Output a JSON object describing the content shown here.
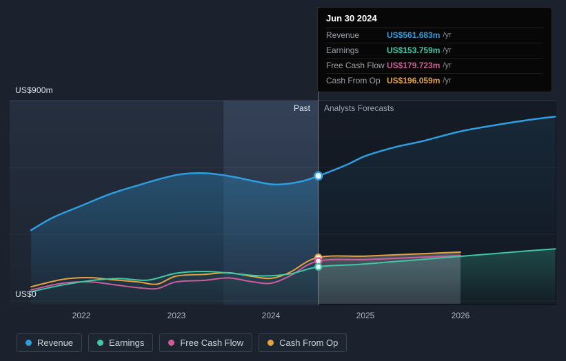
{
  "tooltip": {
    "date": "Jun 30 2024",
    "rows": [
      {
        "label": "Revenue",
        "value": "US$561.683m",
        "suffix": "/yr",
        "color": "#2d9fe0"
      },
      {
        "label": "Earnings",
        "value": "US$153.759m",
        "suffix": "/yr",
        "color": "#40c8a6"
      },
      {
        "label": "Free Cash Flow",
        "value": "US$179.723m",
        "suffix": "/yr",
        "color": "#d05d99"
      },
      {
        "label": "Cash From Op",
        "value": "US$196.059m",
        "suffix": "/yr",
        "color": "#e6a23f"
      }
    ]
  },
  "axis": {
    "y_top": "US$900m",
    "y_bottom": "US$0",
    "x_ticks": [
      "2022",
      "2023",
      "2024",
      "2025",
      "2026"
    ]
  },
  "sections": {
    "past": "Past",
    "forecast": "Analysts Forecasts"
  },
  "legend": [
    {
      "label": "Revenue",
      "color": "#2d9fe0"
    },
    {
      "label": "Earnings",
      "color": "#40c8a6"
    },
    {
      "label": "Free Cash Flow",
      "color": "#d05d99"
    },
    {
      "label": "Cash From Op",
      "color": "#e6a23f"
    }
  ],
  "chart_data": {
    "type": "line",
    "unit": "US$ millions per year",
    "ylim": [
      0,
      900
    ],
    "grid_interval": 300,
    "x_ticks": [
      2022,
      2023,
      2024,
      2025,
      2026
    ],
    "divider_x": 2024.5,
    "divider_date": "Jun 30 2024",
    "past_label": "Past",
    "forecast_label": "Analysts Forecasts",
    "legend_position": "bottom",
    "series": [
      {
        "name": "Revenue",
        "color": "#2d9fe0",
        "current_value": 561.683,
        "x": [
          2021.47,
          2021.7,
          2022,
          2022.3,
          2022.6,
          2022.9,
          2023.1,
          2023.35,
          2023.6,
          2023.85,
          2024.05,
          2024.3,
          2024.5,
          2024.8,
          2025,
          2025.3,
          2025.6,
          2026,
          2026.4,
          2026.7,
          2027
        ],
        "values": [
          318,
          375,
          428,
          480,
          520,
          556,
          572,
          573,
          558,
          536,
          523,
          535,
          561.683,
          612,
          652,
          690,
          718,
          762,
          792,
          812,
          828
        ]
      },
      {
        "name": "Earnings",
        "color": "#40c8a6",
        "current_value": 153.759,
        "x": [
          2021.47,
          2021.8,
          2022.1,
          2022.4,
          2022.7,
          2023,
          2023.3,
          2023.6,
          2023.9,
          2024.2,
          2024.5,
          2024.9,
          2025.3,
          2025.8,
          2026.3,
          2026.7,
          2027
        ],
        "values": [
          42,
          72,
          92,
          101,
          94,
          125,
          133,
          124,
          113,
          122,
          153.759,
          164,
          177,
          194,
          211,
          225,
          234
        ]
      },
      {
        "name": "Free Cash Flow",
        "color": "#d05d99",
        "current_value": 179.723,
        "x": [
          2021.47,
          2021.8,
          2022.1,
          2022.35,
          2022.6,
          2022.8,
          2023,
          2023.3,
          2023.55,
          2023.8,
          2024,
          2024.2,
          2024.5,
          2025,
          2025.5,
          2026
        ],
        "values": [
          50,
          80,
          86,
          73,
          60,
          56,
          86,
          93,
          104,
          87,
          80,
          113,
          179.723,
          186,
          195,
          204
        ]
      },
      {
        "name": "Cash From Op",
        "color": "#e6a23f",
        "current_value": 196.059,
        "x": [
          2021.47,
          2021.8,
          2022.1,
          2022.35,
          2022.6,
          2022.8,
          2023,
          2023.3,
          2023.55,
          2023.8,
          2024,
          2024.2,
          2024.5,
          2025,
          2025.5,
          2026
        ],
        "values": [
          64,
          97,
          105,
          95,
          86,
          76,
          112,
          120,
          127,
          111,
          102,
          129,
          196.059,
          202,
          211,
          220
        ]
      }
    ]
  }
}
